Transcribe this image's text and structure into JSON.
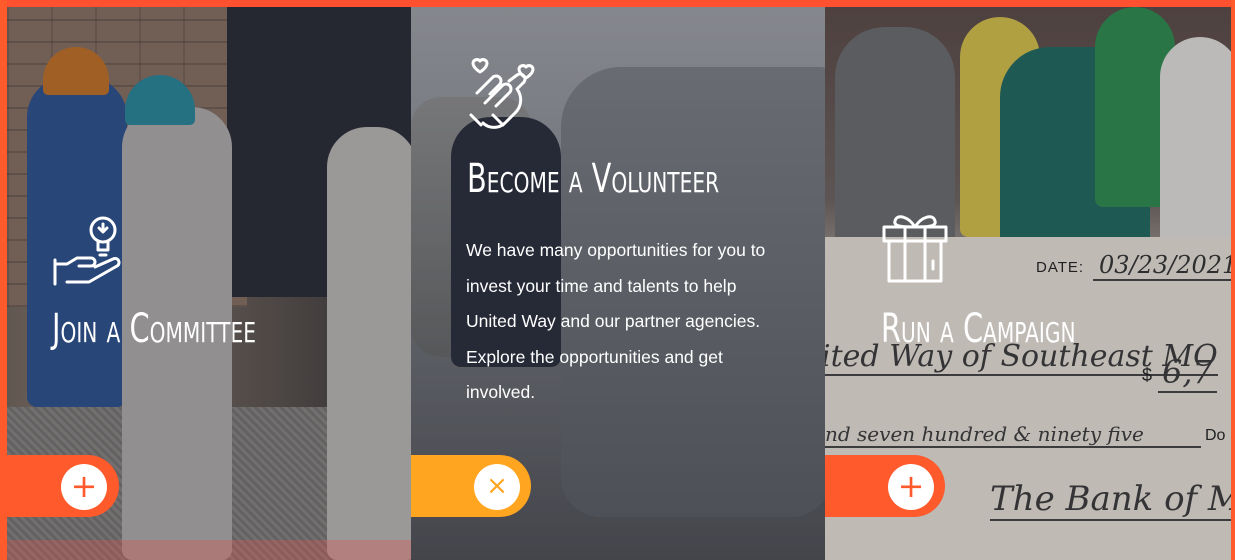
{
  "panels": [
    {
      "title": "Join a Committee",
      "icon": "lightbulb-in-hand-icon",
      "toggle_symbol": "+",
      "toggle_color": "#ff5a2c"
    },
    {
      "title": "Become a Volunteer",
      "icon": "helping-hands-hearts-icon",
      "description": "We have many opportunities for you to invest your time and talents to help United Way and our partner agencies. Explore the opportunities and get involved.",
      "toggle_symbol": "×",
      "toggle_color": "#ffa51f"
    },
    {
      "title": "Run a Campaign",
      "icon": "gift-box-icon",
      "toggle_symbol": "+",
      "toggle_color": "#ff5a2c"
    }
  ],
  "check": {
    "date_label": "DATE:",
    "date_value": "03/23/2021",
    "payee": "ited Way of Southeast MO",
    "dollar_sign": "$",
    "amount": "6,7",
    "amount_words": "nd seven hundred & ninety five",
    "dollars_label": "Do",
    "bank": "The Bank of Missour"
  },
  "colors": {
    "accent_orange": "#ff5a2c",
    "accent_amber": "#ffa51f",
    "text": "#ffffff"
  }
}
